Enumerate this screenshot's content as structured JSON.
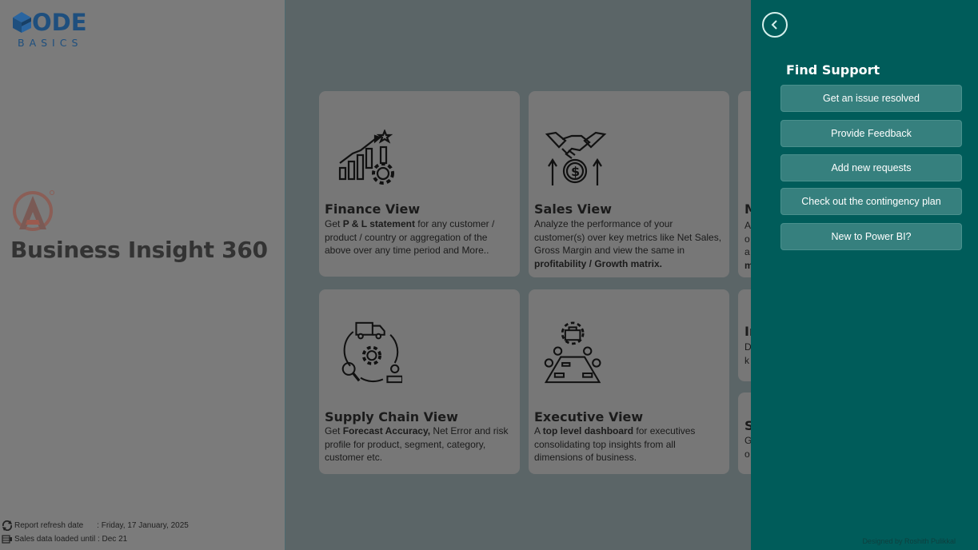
{
  "brand": {
    "logo_text": "ODE",
    "logo_subtext": "BASICS",
    "app_title": "Business Insight 360"
  },
  "footer_info": {
    "refresh_label": "Report refresh date",
    "refresh_value": ": Friday, 17 January, 2025",
    "loaded_text": "Sales data loaded until : Dec 21"
  },
  "tiles": [
    {
      "title": "Finance View",
      "icon": "growth-chart-gear-icon",
      "desc_parts": [
        "Get ",
        "P & L statement",
        " for any customer / product / country or aggregation of the above over any time period and More.."
      ]
    },
    {
      "title": "Sales View",
      "icon": "handshake-dollar-icon",
      "desc_parts": [
        "Analyze the performance of your customer(s) over key metrics like Net Sales, Gross Margin and view the same in ",
        "profitability / Growth matrix."
      ]
    },
    {
      "title": "Supply Chain View",
      "icon": "supply-cycle-icon",
      "desc_parts": [
        "Get ",
        "Forecast Accuracy,",
        " Net Error and risk profile for product, segment, category, customer etc."
      ]
    },
    {
      "title": "Executive View",
      "icon": "executive-meeting-icon",
      "desc_parts": [
        "A ",
        "top level dashboard",
        " for executives consolidating top insights from all dimensions of business."
      ]
    }
  ],
  "partial_tiles": [
    {
      "letter": "M",
      "lines": [
        "A",
        "o",
        "a",
        "m"
      ]
    },
    {
      "letter": "In",
      "lines": [
        "D",
        "k"
      ]
    },
    {
      "letter": "S",
      "lines": [
        "G",
        "o"
      ]
    }
  ],
  "support": {
    "title": "Find Support",
    "back_icon": "chevron-left-icon",
    "buttons": [
      "Get an issue resolved",
      "Provide Feedback",
      "Add new requests",
      "Check out the contingency plan",
      "New to Power BI?"
    ],
    "credit": "Designed by Roshith Pulikkal"
  },
  "colors": {
    "panel": "#005c5a",
    "button": "#36807e",
    "tile": "#777777",
    "left_panel": "#7b7b7b",
    "backdrop": "#5b6567"
  }
}
